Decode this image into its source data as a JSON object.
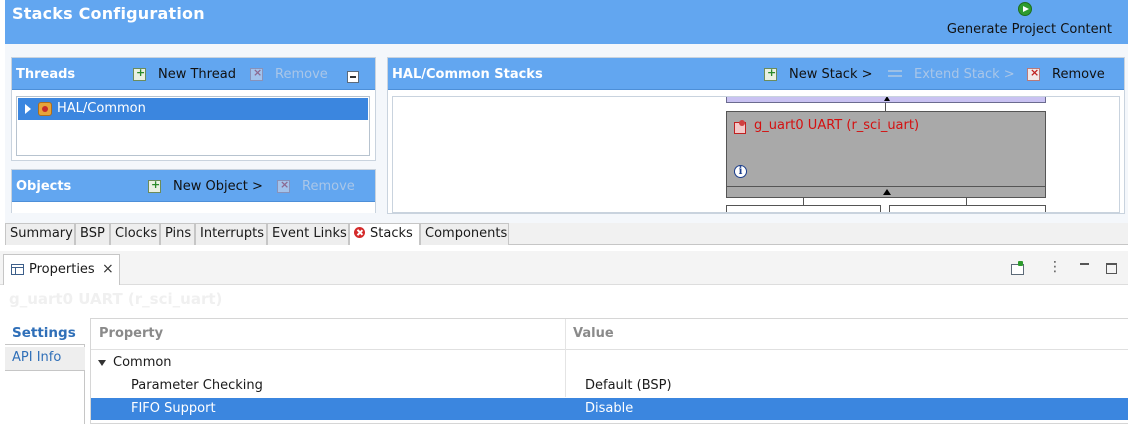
{
  "config": {
    "title": "Stacks Configuration",
    "generate_label": "Generate Project Content"
  },
  "threads": {
    "title": "Threads",
    "new_label": "New Thread",
    "remove_label": "Remove",
    "items": [
      {
        "label": "HAL/Common",
        "selected": true
      }
    ]
  },
  "objects": {
    "title": "Objects",
    "new_label": "New Object >",
    "remove_label": "Remove"
  },
  "stacks": {
    "title": "HAL/Common Stacks",
    "new_label": "New Stack >",
    "extend_label": "Extend Stack >",
    "remove_label": "Remove",
    "module_label": "g_uart0 UART (r_sci_uart)",
    "info_glyph": "i"
  },
  "tabs": [
    {
      "label": "Summary"
    },
    {
      "label": "BSP"
    },
    {
      "label": "Clocks"
    },
    {
      "label": "Pins"
    },
    {
      "label": "Interrupts"
    },
    {
      "label": "Event Links"
    },
    {
      "label": "Stacks",
      "active": true,
      "error": true
    },
    {
      "label": "Components"
    }
  ],
  "properties_view": {
    "tab_label": "Properties",
    "close_glyph": "×",
    "selected_title": "g_uart0 UART (r_sci_uart)",
    "side_tabs": [
      {
        "label": "Settings"
      },
      {
        "label": "API Info"
      }
    ],
    "columns": {
      "property": "Property",
      "value": "Value"
    },
    "group": "Common",
    "rows": [
      {
        "property": "Parameter Checking",
        "value": "Default (BSP)",
        "selected": false
      },
      {
        "property": "FIFO Support",
        "value": "Disable",
        "selected": true
      }
    ]
  },
  "colors": {
    "accent_blue": "#62a6f0",
    "selection_blue": "#3b86df",
    "module_gray": "#a9a9a9",
    "error_red": "#d41010"
  },
  "icons": [
    "generate-icon",
    "add-icon",
    "remove-icon",
    "collapse-icon",
    "extend-icon",
    "thread-icon",
    "module-icon",
    "info-icon",
    "error-icon",
    "properties-icon",
    "pin-icon",
    "view-menu-icon",
    "minimize-icon",
    "maximize-icon",
    "expander-icon"
  ]
}
